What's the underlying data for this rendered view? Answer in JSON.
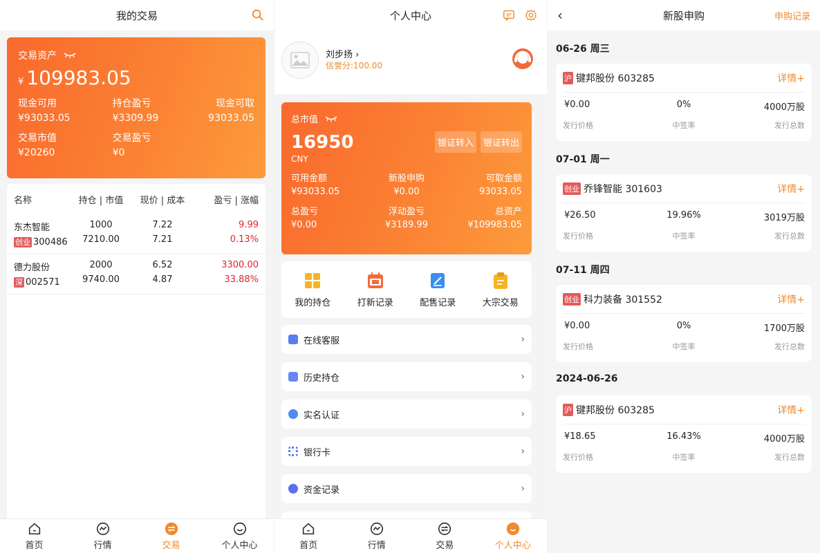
{
  "panel1": {
    "title": "我的交易",
    "asset_label": "交易资产",
    "currency": "¥",
    "asset_value": "109983.05",
    "stats": [
      {
        "label": "现金可用",
        "value": "¥93033.05"
      },
      {
        "label": "持仓盈亏",
        "value": "¥3309.99"
      },
      {
        "label": "现金可取",
        "value": "93033.05"
      },
      {
        "label": "交易市值",
        "value": "¥20260"
      },
      {
        "label": "交易盈亏",
        "value": "¥0"
      }
    ],
    "table_headers": [
      "名称",
      "持仓 | 市值",
      "现价 | 成本",
      "盈亏 | 涨幅"
    ],
    "rows": [
      {
        "name": "东杰智能",
        "tag": "创业",
        "code": "300486",
        "qty": "1000",
        "mv": "7210.00",
        "price": "7.22",
        "cost": "7.21",
        "pl": "9.99",
        "pct": "0.13%"
      },
      {
        "name": "德力股份",
        "tag": "深",
        "code": "002571",
        "qty": "2000",
        "mv": "9740.00",
        "price": "6.52",
        "cost": "4.87",
        "pl": "3300.00",
        "pct": "33.88%"
      }
    ]
  },
  "tabs": [
    "首页",
    "行情",
    "交易",
    "个人中心"
  ],
  "panel2": {
    "title": "个人中心",
    "username": "刘步扬",
    "credit": "信誉分:100.00",
    "mv_label": "总市值",
    "mv_value": "16950",
    "mv_currency": "CNY",
    "btn_in": "银证转入",
    "btn_out": "银证转出",
    "stats": [
      {
        "label": "可用金额",
        "value": "¥93033.05"
      },
      {
        "label": "新股申购",
        "value": "¥0.00"
      },
      {
        "label": "可取金额",
        "value": "93033.05"
      },
      {
        "label": "总盈亏",
        "value": "¥0.00"
      },
      {
        "label": "浮动盈亏",
        "value": "¥3189.99"
      },
      {
        "label": "总资产",
        "value": "¥109983.05"
      }
    ],
    "quick": [
      "我的持仓",
      "打新记录",
      "配售记录",
      "大宗交易"
    ],
    "menu": [
      "在线客服",
      "历史持仓",
      "实名认证",
      "银行卡",
      "资金记录"
    ],
    "colors": {
      "qi1": "#f6b324",
      "qi2": "#f26b3a",
      "qi3": "#3b8ef0",
      "qi4": "#f6b324"
    }
  },
  "panel3": {
    "title": "新股申购",
    "records_link": "申购记录",
    "detail_label": "详情+",
    "labels": [
      "发行价格",
      "中签率",
      "发行总数"
    ],
    "groups": [
      {
        "date": "06-26 周三",
        "items": [
          {
            "mk": "沪",
            "name": "键邦股份 603285",
            "price": "¥0.00",
            "rate": "0%",
            "total": "4000万股"
          }
        ]
      },
      {
        "date": "07-01 周一",
        "items": [
          {
            "mk": "创业",
            "name": "乔锋智能 301603",
            "price": "¥26.50",
            "rate": "19.96%",
            "total": "3019万股"
          }
        ]
      },
      {
        "date": "07-11 周四",
        "items": [
          {
            "mk": "创业",
            "name": "科力装备 301552",
            "price": "¥0.00",
            "rate": "0%",
            "total": "1700万股"
          }
        ]
      },
      {
        "date": "2024-06-26",
        "items": [
          {
            "mk": "沪",
            "name": "键邦股份 603285",
            "price": "¥18.65",
            "rate": "16.43%",
            "total": "4000万股"
          }
        ]
      }
    ]
  },
  "accent": "#f08a2c",
  "loss_color": "#e0242b"
}
